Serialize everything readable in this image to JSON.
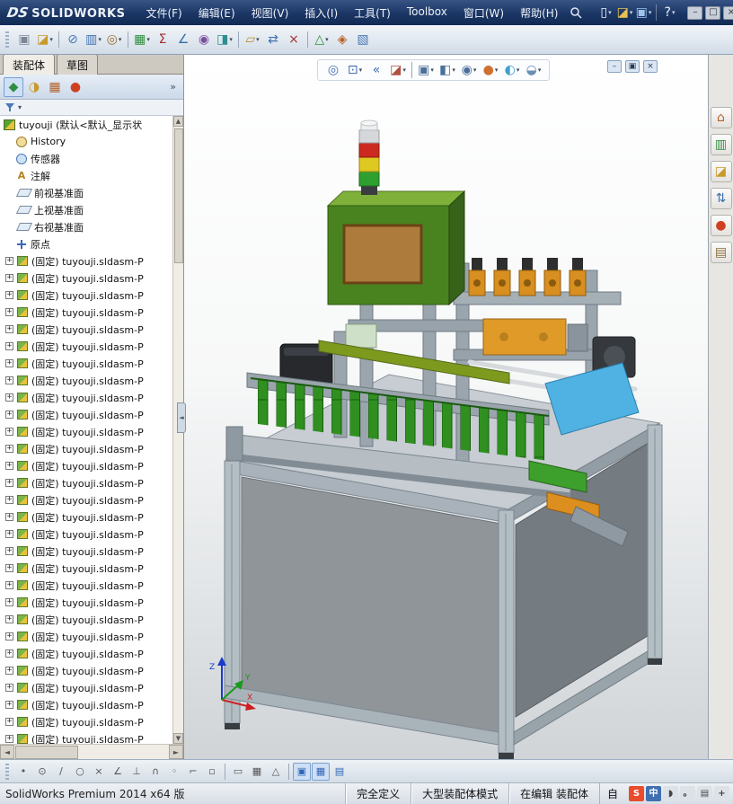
{
  "colors": {
    "accent": "#2f66b8",
    "titlebar": "#1b3665",
    "toolbar": "#d2dce7",
    "tree_bg": "#ffffff"
  },
  "titlebar": {
    "brand_mark": "DS",
    "brand": "SOLIDWORKS",
    "menus": [
      "文件(F)",
      "编辑(E)",
      "视图(V)",
      "插入(I)",
      "工具(T)",
      "Toolbox",
      "窗口(W)",
      "帮助(H)"
    ],
    "quick_icons": [
      {
        "name": "new-document-icon",
        "glyph": "▯",
        "color": "#f5f7fa",
        "caret": true
      },
      {
        "name": "open-document-icon",
        "glyph": "◪",
        "color": "#e8c050",
        "caret": true
      },
      {
        "name": "save-icon",
        "glyph": "▣",
        "color": "#9cc4ee",
        "caret": true
      },
      {
        "sep": true
      },
      {
        "name": "help-icon",
        "glyph": "?",
        "color": "#f5f7fa",
        "caret": true
      }
    ],
    "window_buttons": [
      {
        "name": "minimize-button",
        "glyph": "–",
        "color": "#2a3440"
      },
      {
        "name": "maximize-button",
        "glyph": "□",
        "color": "#2a3440"
      },
      {
        "name": "close-button",
        "glyph": "×",
        "color": "#2a3440"
      }
    ]
  },
  "main_toolbar": {
    "icons": [
      {
        "name": "screenshot-icon",
        "glyph": "▣",
        "color": "#7c8796"
      },
      {
        "name": "open-recent-icon",
        "glyph": "◪",
        "color": "#c79a2a",
        "caret": true
      },
      {
        "sep": true
      },
      {
        "name": "attach-file-icon",
        "glyph": "⊘",
        "color": "#4a7ab5"
      },
      {
        "name": "compare-documents-icon",
        "glyph": "▥",
        "color": "#3f6fb0",
        "caret": true
      },
      {
        "name": "find-references-icon",
        "glyph": "◎",
        "color": "#9a6f2f",
        "caret": true
      },
      {
        "sep": true
      },
      {
        "name": "design-table-icon",
        "glyph": "▦",
        "color": "#2f8f3f",
        "caret": true
      },
      {
        "name": "equations-icon",
        "glyph": "Σ",
        "color": "#a03030"
      },
      {
        "name": "measure-icon",
        "glyph": "∠",
        "color": "#2f6fb0"
      },
      {
        "name": "mass-properties-icon",
        "glyph": "◉",
        "color": "#7a4fa0"
      },
      {
        "name": "section-properties-icon",
        "glyph": "◨",
        "color": "#2f8f8f",
        "caret": true
      },
      {
        "sep": true
      },
      {
        "name": "sketch-entities-icon",
        "glyph": "▱",
        "color": "#b58a2a",
        "caret": true
      },
      {
        "name": "convert-entities-icon",
        "glyph": "⇄",
        "color": "#3f6fb0"
      },
      {
        "name": "trim-entities-icon",
        "glyph": "×",
        "color": "#a03030"
      },
      {
        "sep": true
      },
      {
        "name": "exploded-view-icon",
        "glyph": "△",
        "color": "#2f8f3f",
        "caret": true
      },
      {
        "name": "interference-check-icon",
        "glyph": "◈",
        "color": "#b5622a"
      },
      {
        "name": "assembly-visualization-icon",
        "glyph": "▧",
        "color": "#4a7ab5"
      }
    ]
  },
  "left_panel": {
    "tabs": [
      {
        "label": "装配体",
        "active": true
      },
      {
        "label": "草图",
        "active": false
      }
    ],
    "manager_tabs": [
      {
        "name": "featuremanager-tab-icon",
        "glyph": "◆",
        "color": "#2f8f3f",
        "active": true
      },
      {
        "name": "propertymanager-tab-icon",
        "glyph": "◑",
        "color": "#c79a2a"
      },
      {
        "name": "configurationmanager-tab-icon",
        "glyph": "▦",
        "color": "#b5622a"
      },
      {
        "name": "displaymanager-tab-icon",
        "glyph": "●",
        "color": "#d04020"
      }
    ],
    "more_chevron": "»",
    "tree": {
      "root": "tuyouji (默认<默认_显示状",
      "items": [
        "History",
        "传感器",
        "注解",
        "前视基准面",
        "上视基准面",
        "右视基准面",
        "原点"
      ],
      "components": [
        "(固定) tuyouji.sldasm-P",
        "(固定) tuyouji.sldasm-P",
        "(固定) tuyouji.sldasm-P",
        "(固定) tuyouji.sldasm-P",
        "(固定) tuyouji.sldasm-P",
        "(固定) tuyouji.sldasm-P",
        "(固定) tuyouji.sldasm-P",
        "(固定) tuyouji.sldasm-P",
        "(固定) tuyouji.sldasm-P",
        "(固定) tuyouji.sldasm-P",
        "(固定) tuyouji.sldasm-P",
        "(固定) tuyouji.sldasm-P",
        "(固定) tuyouji.sldasm-P",
        "(固定) tuyouji.sldasm-P",
        "(固定) tuyouji.sldasm-P",
        "(固定) tuyouji.sldasm-P",
        "(固定) tuyouji.sldasm-P",
        "(固定) tuyouji.sldasm-P",
        "(固定) tuyouji.sldasm-P",
        "(固定) tuyouji.sldasm-P",
        "(固定) tuyouji.sldasm-P",
        "(固定) tuyouji.sldasm-P",
        "(固定) tuyouji.sldasm-P",
        "(固定) tuyouji.sldasm-P",
        "(固定) tuyouji.sldasm-P",
        "(固定) tuyouji.sldasm-P",
        "(固定) tuyouji.sldasm-P",
        "(固定) tuyouji.sldasm-P",
        "(固定) tuyouji.sldasm-P"
      ]
    }
  },
  "viewport": {
    "hud_icons": [
      {
        "name": "zoom-fit-icon",
        "glyph": "◎",
        "color": "#3f6fb0"
      },
      {
        "name": "zoom-area-icon",
        "glyph": "⊡",
        "color": "#3f6fb0",
        "caret": true
      },
      {
        "name": "previous-view-icon",
        "glyph": "«",
        "color": "#3f6fb0"
      },
      {
        "name": "section-view-icon",
        "glyph": "◪",
        "color": "#b0503f",
        "caret": true
      },
      {
        "sep": true
      },
      {
        "name": "view-orientation-icon",
        "glyph": "▣",
        "color": "#4a6f9a",
        "caret": true
      },
      {
        "name": "display-style-icon",
        "glyph": "◧",
        "color": "#4a6f9a",
        "caret": true
      },
      {
        "name": "hide-show-items-icon",
        "glyph": "◉",
        "color": "#4a6f9a",
        "caret": true
      },
      {
        "name": "edit-appearance-icon",
        "glyph": "●",
        "color": "#d07030",
        "caret": true
      },
      {
        "name": "apply-scene-icon",
        "glyph": "◐",
        "color": "#3fa0d0",
        "caret": true
      },
      {
        "name": "view-settings-icon",
        "glyph": "◒",
        "color": "#6a8fb5",
        "caret": true
      }
    ],
    "doc_window_buttons": [
      {
        "name": "doc-minimize-icon",
        "glyph": "–",
        "color": "#2a3a55"
      },
      {
        "name": "doc-restore-icon",
        "glyph": "▣",
        "color": "#2a3a55"
      },
      {
        "name": "doc-close-icon",
        "glyph": "×",
        "color": "#2a3a55"
      }
    ],
    "triad": {
      "x": "X",
      "y": "Y",
      "z": "Z"
    }
  },
  "taskpane": {
    "icons": [
      {
        "name": "solidworks-resources-icon",
        "glyph": "⌂",
        "color": "#b5622a"
      },
      {
        "name": "design-library-icon",
        "glyph": "▥",
        "color": "#2f8f3f"
      },
      {
        "name": "file-explorer-icon",
        "glyph": "◪",
        "color": "#c79a2a"
      },
      {
        "name": "view-palette-icon",
        "glyph": "⇅",
        "color": "#3f6fb0"
      },
      {
        "name": "appearances-icon",
        "glyph": "●",
        "color": "#d04020"
      },
      {
        "name": "custom-properties-icon",
        "glyph": "▤",
        "color": "#8a6f3f"
      }
    ]
  },
  "snapbar": {
    "icons": [
      {
        "name": "point-snap-icon",
        "glyph": "•",
        "color": "#555555"
      },
      {
        "name": "center-snap-icon",
        "glyph": "⊙",
        "color": "#555555"
      },
      {
        "name": "line-snap-icon",
        "glyph": "/",
        "color": "#555555"
      },
      {
        "name": "circle-snap-icon",
        "glyph": "○",
        "color": "#555555"
      },
      {
        "name": "intersection-snap-icon",
        "glyph": "×",
        "color": "#555555"
      },
      {
        "name": "angle-snap-icon",
        "glyph": "∠",
        "color": "#555555"
      },
      {
        "name": "perpendicular-snap-icon",
        "glyph": "⊥",
        "color": "#555555"
      },
      {
        "name": "tangent-snap-icon",
        "glyph": "∩",
        "color": "#555555"
      },
      {
        "name": "midpoint-snap-icon",
        "glyph": "◦",
        "color": "#555555"
      },
      {
        "name": "corner-snap-icon",
        "glyph": "⌐",
        "color": "#555555"
      },
      {
        "name": "selection-filter-icon",
        "glyph": "▫",
        "color": "#555555"
      },
      {
        "sep": true
      },
      {
        "name": "grid-snap-icon",
        "glyph": "▭",
        "color": "#555555"
      },
      {
        "name": "grid-display-icon",
        "glyph": "▦",
        "color": "#555555"
      },
      {
        "name": "angle-grid-icon",
        "glyph": "△",
        "color": "#555555"
      },
      {
        "sep": true
      },
      {
        "name": "snap-toggle-icon",
        "glyph": "▣",
        "color": "#2f66b8",
        "active": true
      },
      {
        "name": "grid-toggle-icon",
        "glyph": "▦",
        "color": "#2f66b8",
        "active": true
      },
      {
        "name": "snap-options-icon",
        "glyph": "▤",
        "color": "#2f66b8"
      }
    ]
  },
  "statusbar": {
    "product": "SolidWorks Premium 2014 x64 版",
    "segments": [
      "完全定义",
      "大型装配体模式",
      "在编辑 装配体"
    ],
    "tray_text": "自",
    "tray_icons": [
      {
        "name": "sogou-input-icon",
        "glyph": "S",
        "color": "#ffffff",
        "bg": "#e84c2b"
      },
      {
        "name": "chinese-mode-icon",
        "glyph": "中",
        "color": "#ffffff",
        "bg": "#3f6fb0"
      },
      {
        "name": "fullwidth-icon",
        "glyph": "◗",
        "color": "#444444",
        "bg": "#dde2e8"
      },
      {
        "name": "punctuation-icon",
        "glyph": "。",
        "color": "#444444",
        "bg": "#dde2e8"
      },
      {
        "name": "keyboard-icon",
        "glyph": "▤",
        "color": "#444444",
        "bg": "#dde2e8"
      },
      {
        "name": "input-settings-icon",
        "glyph": "+",
        "color": "#444444",
        "bg": "#dde2e8"
      }
    ]
  }
}
